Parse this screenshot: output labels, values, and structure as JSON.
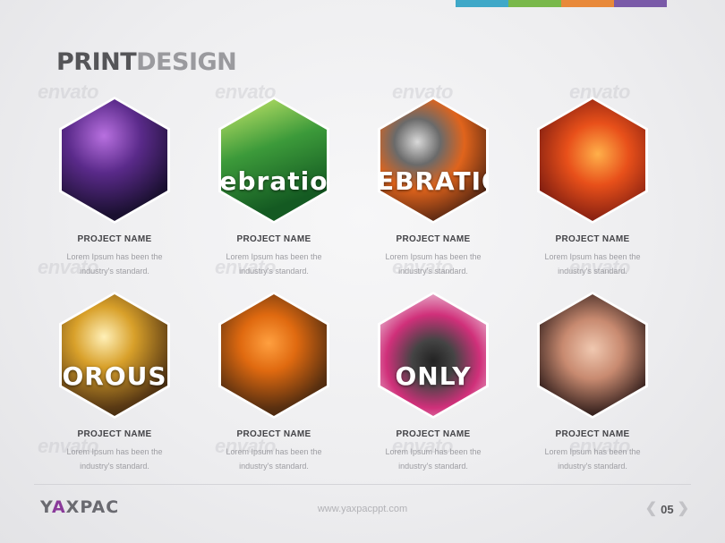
{
  "header": {
    "strip_colors": [
      "#3fa8c8",
      "#79b84b",
      "#e8893a",
      "#7a5aa8"
    ],
    "title_part1": "PRINT",
    "title_part2": "DESIGN"
  },
  "watermark_text": "envato",
  "projects": [
    {
      "name": "PROJECT NAME",
      "desc_line1": "Lorem Ipsum has been the",
      "desc_line2": "industry's standard.",
      "image_text": "",
      "image_theme": "purple-party"
    },
    {
      "name": "PROJECT NAME",
      "desc_line1": "Lorem Ipsum has been the",
      "desc_line2": "industry's standard.",
      "image_text": "ebratio",
      "image_theme": "green-celebration"
    },
    {
      "name": "PROJECT NAME",
      "desc_line1": "Lorem Ipsum has been the",
      "desc_line2": "industry's standard.",
      "image_text": "EBRATIO",
      "image_theme": "gasmask-orange"
    },
    {
      "name": "PROJECT NAME",
      "desc_line1": "Lorem Ipsum has been the",
      "desc_line2": "industry's standard.",
      "image_text": "",
      "image_theme": "halloween-red"
    },
    {
      "name": "PROJECT NAME",
      "desc_line1": "Lorem Ipsum has been the",
      "desc_line2": "industry's standard.",
      "image_text": "OROUS",
      "image_theme": "gold-casino"
    },
    {
      "name": "PROJECT NAME",
      "desc_line1": "Lorem Ipsum has been the",
      "desc_line2": "industry's standard.",
      "image_text": "",
      "image_theme": "pumpkin"
    },
    {
      "name": "PROJECT NAME",
      "desc_line1": "Lorem Ipsum has been the",
      "desc_line2": "industry's standard.",
      "image_text": "ONLY",
      "image_theme": "vinyl-pink"
    },
    {
      "name": "PROJECT NAME",
      "desc_line1": "Lorem Ipsum has been the",
      "desc_line2": "industry's standard.",
      "image_text": "",
      "image_theme": "portrait"
    }
  ],
  "footer": {
    "brand_part1": "Y",
    "brand_accent": "A",
    "brand_part2": "XPAC",
    "url": "www.yaxpacppt.com",
    "page_number": "05",
    "prev_icon": "chevron-left-icon",
    "next_icon": "chevron-right-icon"
  }
}
